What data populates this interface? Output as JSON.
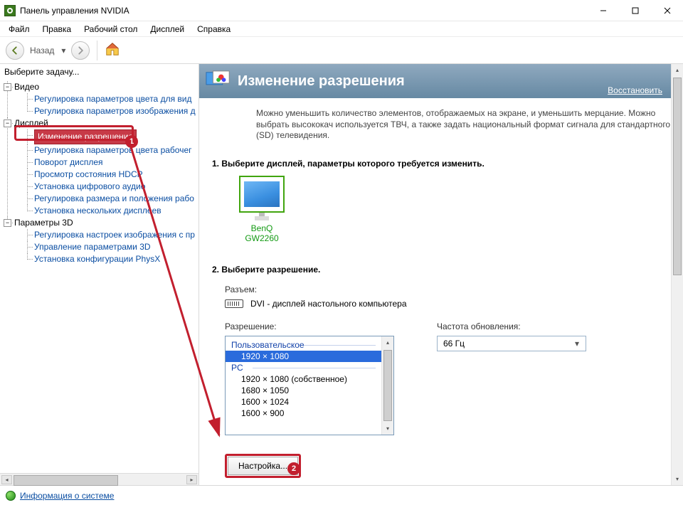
{
  "window": {
    "title": "Панель управления NVIDIA"
  },
  "menu": {
    "file": "Файл",
    "edit": "Правка",
    "desktop": "Рабочий стол",
    "display": "Дисплей",
    "help": "Справка"
  },
  "toolbar": {
    "back": "Назад"
  },
  "tree": {
    "header": "Выберите задачу...",
    "video": {
      "label": "Видео",
      "color": "Регулировка параметров цвета для вид",
      "image": "Регулировка параметров изображения д"
    },
    "display": {
      "label": "Дисплей",
      "resolution": "Изменение разрешения",
      "deskcolor": "Регулировка параметров цвета рабочег",
      "rotate": "Поворот дисплея",
      "hdcp": "Просмотр состояния HDCP",
      "digaudio": "Установка цифрового аудио",
      "sizepos": "Регулировка размера и положения рабо",
      "multiple": "Установка нескольких дисплеев"
    },
    "three_d": {
      "label": "Параметры 3D",
      "imgsettings": "Регулировка настроек изображения с пр",
      "manage": "Управление параметрами 3D",
      "physx": "Установка конфигурации PhysX"
    }
  },
  "content": {
    "title": "Изменение разрешения",
    "restore": "Восстановить",
    "description": "Можно уменьшить количество элементов, отображаемых на экране, и уменьшить мерцание. Можно выбрать высококач используется ТВЧ, а также задать национальный формат сигнала для стандартного (SD) телевидения.",
    "step1_title": "1. Выберите дисплей, параметры которого требуется изменить.",
    "monitor_name": "BenQ GW2260",
    "step2_title": "2. Выберите разрешение.",
    "connector_label": "Разъем:",
    "connector_value": "DVI - дисплей настольного компьютера",
    "resolution_label": "Разрешение:",
    "refresh_label": "Частота обновления:",
    "refresh_value": "66 Гц",
    "custom_group": "Пользовательское",
    "custom_item": "1920 × 1080",
    "pc_group": "PC",
    "pc_items": {
      "r0": "1920 × 1080 (собственное)",
      "r1": "1680 × 1050",
      "r2": "1600 × 1024",
      "r3": "1600 × 900"
    },
    "customize_btn": "Настройка..."
  },
  "status": {
    "sysinfo": "Информация о системе"
  },
  "annotations": {
    "a1": "1",
    "a2": "2"
  }
}
